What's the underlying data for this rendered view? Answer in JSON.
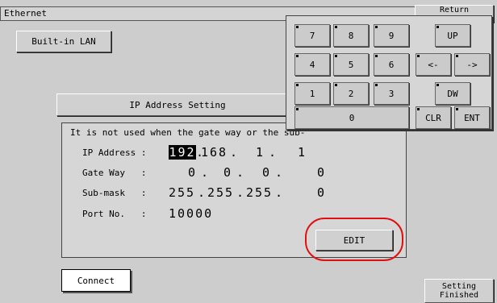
{
  "window": {
    "title": "Ethernet"
  },
  "buttons": {
    "builtin_lan": "Built-in LAN",
    "return": "Return",
    "connect": "Connect",
    "setting_finished_line1": "Setting",
    "setting_finished_line2": "Finished",
    "edit": "EDIT"
  },
  "ip_setting": {
    "title": "IP Address Setting",
    "note": "It is not used when the gate way or the sub-",
    "rows": [
      {
        "label": "IP Address :",
        "octets": [
          "192",
          "168",
          "1",
          "1"
        ]
      },
      {
        "label": "Gate Way   :",
        "octets": [
          "0",
          "0",
          "0",
          "0"
        ]
      },
      {
        "label": "Sub-mask   :",
        "octets": [
          "255",
          "255",
          "255",
          "0"
        ]
      },
      {
        "label": "Port No.   :",
        "value": "10000"
      }
    ]
  },
  "keypad": {
    "keys": [
      "7",
      "8",
      "9",
      "4",
      "5",
      "6",
      "1",
      "2",
      "3",
      "0"
    ],
    "up": "UP",
    "left": "<-",
    "right": "->",
    "down": "DW",
    "clear": "CLR",
    "enter": "ENT"
  },
  "colors": {
    "highlight": "#e01010",
    "background": "#cdcdcd"
  }
}
